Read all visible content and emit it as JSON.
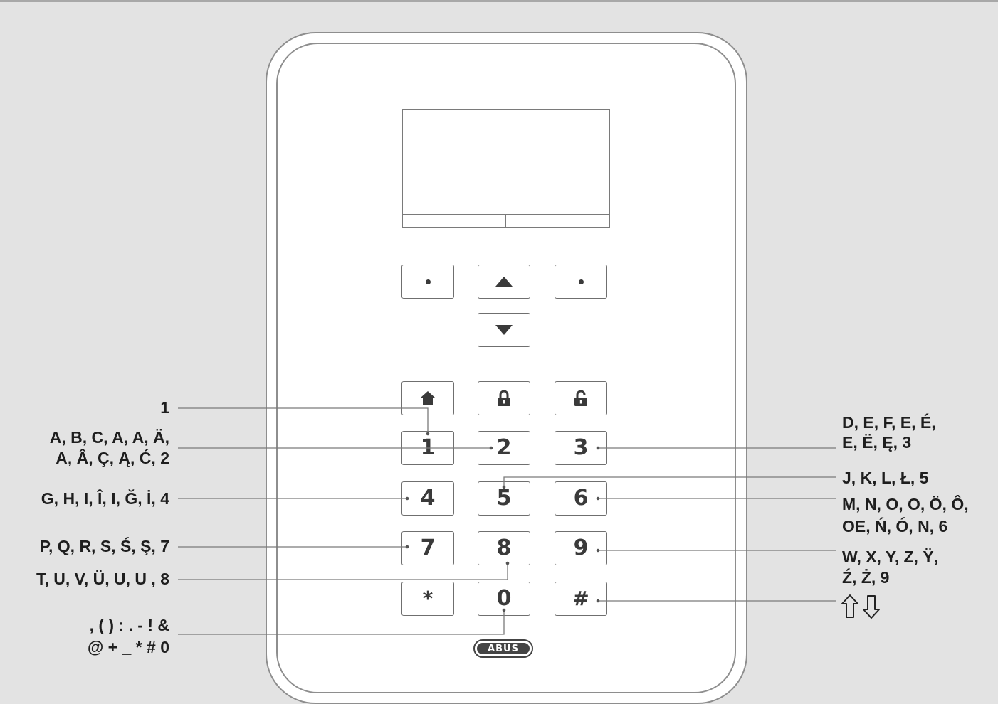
{
  "logo": {
    "text": "ABUS"
  },
  "keys": {
    "soft_left": "•",
    "soft_right": "•",
    "up_icon": "triangle-up",
    "down_icon": "triangle-down",
    "home_icon": "house",
    "lock_icon": "padlock-closed",
    "unlock_icon": "padlock-open",
    "k1": "1",
    "k2": "2",
    "k3": "3",
    "k4": "4",
    "k5": "5",
    "k6": "6",
    "k7": "7",
    "k8": "8",
    "k9": "9",
    "star": "*",
    "k0": "0",
    "hash": "#"
  },
  "labels_left": {
    "key1": "1",
    "key2_line1": "A, B, C, A, A, Ä,",
    "key2_line2": "A, Â, Ç, Ą, Ć, 2",
    "key4": "G, H, I, Î, I, Ğ, İ, 4",
    "key7": "P, Q, R, S, Ś, Ş, 7",
    "key8": "T, U, V, Ü, U, U , 8",
    "key0_line1": ", ( ) : . - ! &",
    "key0_line2": "@ + _ * # 0"
  },
  "labels_right": {
    "key3_line1": "D, E, F, E, É,",
    "key3_line2": "E, Ë, Ę, 3",
    "key5": "J, K, L, Ł, 5",
    "key6_line1": "M, N, O, O, Ö, Ô,",
    "key6_line2": "OE, Ń, Ó, N, 6",
    "key9_line1": "W, X, Y, Z, Ÿ,",
    "key9_line2": "Ź, Ż, 9",
    "hash_icons": "up-down-arrows"
  }
}
